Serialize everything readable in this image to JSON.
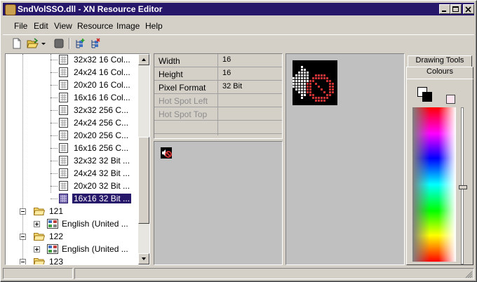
{
  "window": {
    "title": "SndVolSSO.dll - XN Resource Editor"
  },
  "menu": [
    "File",
    "Edit",
    "View",
    "Resource",
    "Image",
    "Help"
  ],
  "toolbar": {
    "buttons": [
      "new-file-icon",
      "open-folder-icon",
      "dropdown-arrow-icon",
      "stop-icon",
      "add-resource-icon",
      "delete-resource-icon"
    ]
  },
  "tree": {
    "image_items": [
      "32x32 16 Col...",
      "24x24 16 Col...",
      "20x20 16 Col...",
      "16x16 16 Col...",
      "32x32 256 C...",
      "24x24 256 C...",
      "20x20 256 C...",
      "16x16 256 C...",
      "32x32 32 Bit ...",
      "24x24 32 Bit ...",
      "20x20 32 Bit ...",
      "16x16 32 Bit ..."
    ],
    "selected_index": 11,
    "groups": [
      {
        "label": "121",
        "child": "English (United ..."
      },
      {
        "label": "122",
        "child": "English (United ..."
      },
      {
        "label": "123"
      }
    ]
  },
  "properties": [
    {
      "name": "Width",
      "value": "16",
      "enabled": true
    },
    {
      "name": "Height",
      "value": "16",
      "enabled": true
    },
    {
      "name": "Pixel Format",
      "value": "32 Bit",
      "enabled": true
    },
    {
      "name": "Hot Spot Left",
      "value": "",
      "enabled": false
    },
    {
      "name": "Hot Spot Top",
      "value": "",
      "enabled": false
    }
  ],
  "tabs": {
    "drawing_tools": "Drawing Tools",
    "colours": "Colours"
  },
  "colors": {
    "title_bg": "#27176b",
    "selection": "#27176b",
    "speaker_white": "#ffffff",
    "mute_red": "#c83232"
  }
}
